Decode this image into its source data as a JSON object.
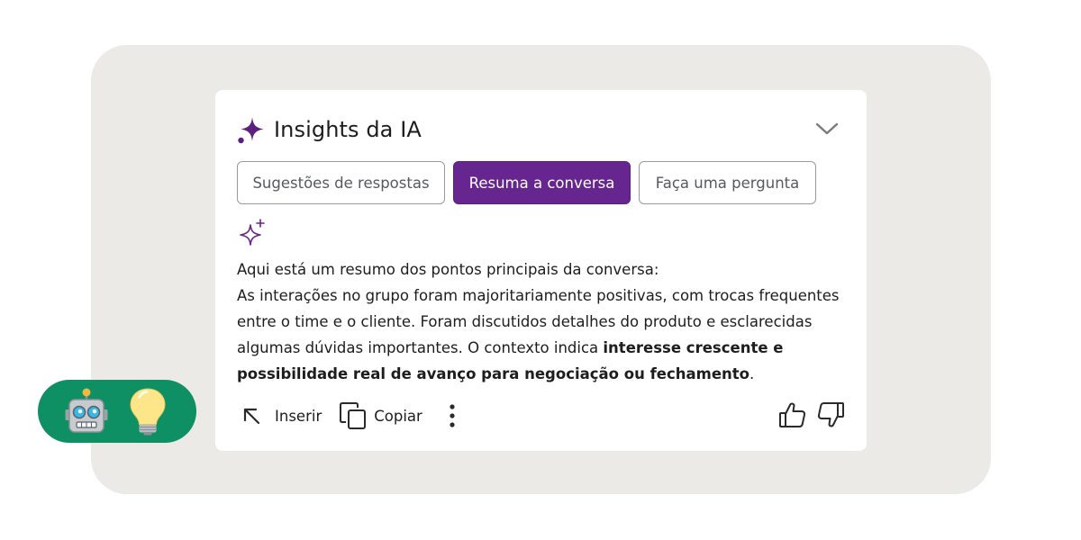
{
  "card": {
    "title": "Insights da IA",
    "collapse_icon": "chevron-down-icon"
  },
  "tabs": [
    {
      "label": "Sugestões de respostas",
      "active": false
    },
    {
      "label": "Resuma a conversa",
      "active": true
    },
    {
      "label": "Faça uma pergunta",
      "active": false
    }
  ],
  "summary": {
    "icon": "sparkles-outline-icon",
    "intro": "Aqui está um resumo dos pontos principais da conversa:",
    "line1": "As interações no grupo foram majoritariamente positivas, com trocas frequentes",
    "line2": "entre o time e o cliente. Foram discutidos detalhes do produto e esclarecidas",
    "line3_regular": "algumas dúvidas importantes. O contexto indica ",
    "line3_bold": "interesse crescente e",
    "line4_bold": "possibilidade real de avanço para negociação ou fechamento",
    "line4_end": "."
  },
  "actions": {
    "insert_label": "Inserir",
    "copy_label": "Copiar",
    "more_icon": "more-vertical-icon"
  },
  "feedback": {
    "like_icon": "thumbs-up-icon",
    "dislike_icon": "thumbs-down-icon"
  },
  "badge": {
    "icons": [
      "robot-icon",
      "lightbulb-icon"
    ]
  },
  "colors": {
    "accent": "#67268f",
    "badge": "#0e8f64",
    "backdrop": "#ebeae6"
  }
}
